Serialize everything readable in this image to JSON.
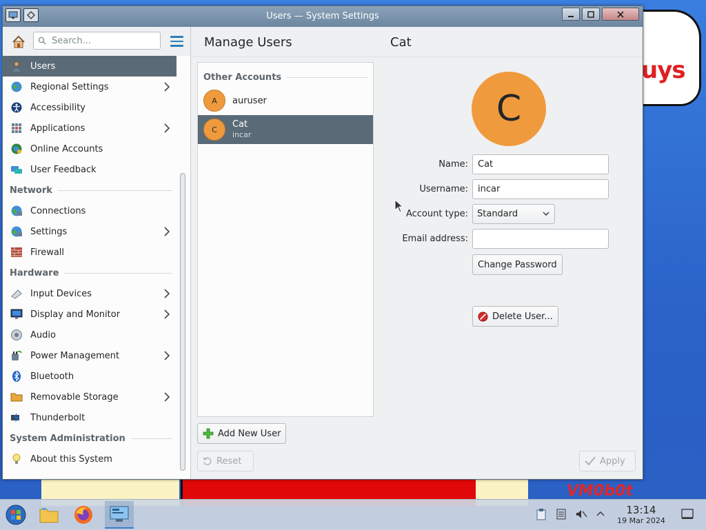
{
  "window": {
    "title": "Users — System Settings"
  },
  "sidebar": {
    "search_placeholder": "Search...",
    "groups": [
      {
        "header": "",
        "items": [
          {
            "label": "Users",
            "icon": "users-icon",
            "selected": true,
            "has_submenu": false
          },
          {
            "label": "Regional Settings",
            "icon": "globe-flag-icon",
            "has_submenu": true
          },
          {
            "label": "Accessibility",
            "icon": "accessibility-icon",
            "has_submenu": false
          },
          {
            "label": "Applications",
            "icon": "applications-grid-icon",
            "has_submenu": true
          },
          {
            "label": "Online Accounts",
            "icon": "online-accounts-icon",
            "has_submenu": false
          },
          {
            "label": "User Feedback",
            "icon": "user-feedback-icon",
            "has_submenu": false
          }
        ]
      },
      {
        "header": "Network",
        "items": [
          {
            "label": "Connections",
            "icon": "connections-icon",
            "has_submenu": false
          },
          {
            "label": "Settings",
            "icon": "network-settings-icon",
            "has_submenu": true
          },
          {
            "label": "Firewall",
            "icon": "firewall-icon",
            "has_submenu": false
          }
        ]
      },
      {
        "header": "Hardware",
        "items": [
          {
            "label": "Input Devices",
            "icon": "keyboard-mouse-icon",
            "has_submenu": true
          },
          {
            "label": "Display and Monitor",
            "icon": "monitor-icon",
            "has_submenu": true
          },
          {
            "label": "Audio",
            "icon": "speaker-icon",
            "has_submenu": false
          },
          {
            "label": "Power Management",
            "icon": "power-plug-icon",
            "has_submenu": true
          },
          {
            "label": "Bluetooth",
            "icon": "bluetooth-icon",
            "has_submenu": false
          },
          {
            "label": "Removable Storage",
            "icon": "folder-drive-icon",
            "has_submenu": true
          },
          {
            "label": "Thunderbolt",
            "icon": "thunderbolt-icon",
            "has_submenu": false
          }
        ]
      },
      {
        "header": "System Administration",
        "items": [
          {
            "label": "About this System",
            "icon": "lightbulb-icon",
            "has_submenu": false
          }
        ]
      }
    ]
  },
  "main": {
    "title": "Manage Users",
    "accounts_section": "Other Accounts",
    "accounts": [
      {
        "initial": "A",
        "name": "auruser",
        "username": "",
        "selected": false
      },
      {
        "initial": "C",
        "name": "Cat",
        "username": "incar",
        "selected": true
      }
    ],
    "add_user_label": "Add New User",
    "reset_label": "Reset",
    "apply_label": "Apply"
  },
  "detail": {
    "title": "Cat",
    "avatar_initial": "C",
    "name_label": "Name:",
    "name_value": "Cat",
    "username_label": "Username:",
    "username_value": "incar",
    "account_type_label": "Account type:",
    "account_type_value": "Standard",
    "email_label": "Email address:",
    "email_value": "",
    "change_password_label": "Change Password",
    "delete_user_label": "Delete User..."
  },
  "desktop": {
    "wallpaper_text_1": "uys",
    "wallpaper_text_2": "VM0b0t"
  },
  "taskbar": {
    "time": "13:14",
    "date": "19 Mar 2024"
  },
  "colors": {
    "selection": "#5a6b77",
    "avatar": "#f09a3e",
    "accent": "#2980b9"
  }
}
